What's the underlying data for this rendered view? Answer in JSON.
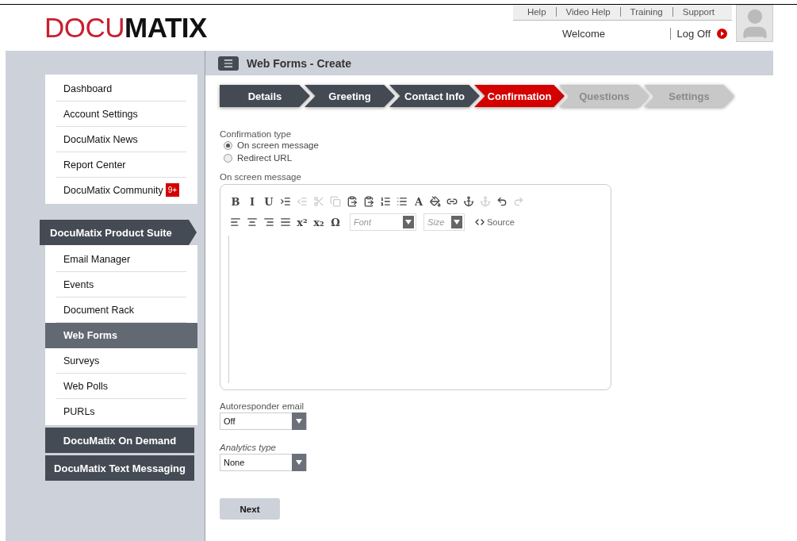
{
  "header": {
    "logo": "DOCU**MATIX**",
    "links": [
      "Help",
      "Video Help",
      "Training",
      "Support"
    ],
    "welcome": "Welcome",
    "logoff": "Log Off"
  },
  "page_title": "Web Forms - Create",
  "sidebar": {
    "top_items": [
      {
        "label": "Dashboard"
      },
      {
        "label": "Account Settings"
      },
      {
        "label": "DocuMatix News"
      },
      {
        "label": "Report Center"
      },
      {
        "label": "DocuMatix Community",
        "badge": "9+"
      }
    ],
    "sections": [
      {
        "label": "DocuMatix Product Suite",
        "expanded": true,
        "items": [
          {
            "label": "Email Manager",
            "selected": false
          },
          {
            "label": "Events",
            "selected": false
          },
          {
            "label": "Document Rack",
            "selected": false
          },
          {
            "label": "Web Forms",
            "selected": true
          },
          {
            "label": "Surveys",
            "selected": false
          },
          {
            "label": "Web Polls",
            "selected": false
          },
          {
            "label": "PURLs",
            "selected": false
          }
        ]
      },
      {
        "label": "DocuMatix On Demand",
        "expanded": false
      },
      {
        "label": "DocuMatix Text Messaging",
        "expanded": false
      }
    ]
  },
  "steps": [
    {
      "label": "Details",
      "completed": true,
      "selected": false
    },
    {
      "label": "Greeting",
      "completed": true,
      "selected": false
    },
    {
      "label": "Contact Info",
      "completed": true,
      "selected": false
    },
    {
      "label": "Confirmation",
      "completed": false,
      "selected": true
    },
    {
      "label": "Questions",
      "completed": false,
      "selected": false
    },
    {
      "label": "Settings",
      "completed": false,
      "selected": false
    }
  ],
  "confirmation_type": {
    "label": "Confirmation type",
    "options": [
      {
        "label": "On screen message",
        "selected": true
      },
      {
        "label": "Redirect URL",
        "selected": false
      }
    ]
  },
  "editor": {
    "label": "On screen message",
    "toolbar_1": [
      {
        "kind": "glyph",
        "label": "B",
        "disabled": false
      },
      {
        "kind": "glyph",
        "label": "I",
        "disabled": false
      },
      {
        "kind": "glyph",
        "label": "U",
        "disabled": false
      },
      {
        "kind": "indent",
        "disabled": false
      },
      {
        "kind": "outdent",
        "disabled": true
      },
      {
        "kind": "cut",
        "disabled": true
      },
      {
        "kind": "copy",
        "disabled": true
      },
      {
        "kind": "paste",
        "disabled": false
      },
      {
        "kind": "paste",
        "disabled": false
      },
      {
        "kind": "ordered-list",
        "disabled": false
      },
      {
        "kind": "bullet-list",
        "disabled": false
      },
      {
        "kind": "glyph",
        "label": "A",
        "disabled": false
      },
      {
        "kind": "fill",
        "disabled": false
      },
      {
        "kind": "link",
        "disabled": false
      },
      {
        "kind": "anchor",
        "disabled": false
      },
      {
        "kind": "anchor",
        "disabled": true
      },
      {
        "kind": "undo",
        "disabled": false
      },
      {
        "kind": "redo",
        "disabled": true
      }
    ],
    "toolbar_2": [
      {
        "kind": "align-left",
        "disabled": false
      },
      {
        "kind": "align-center",
        "disabled": false
      },
      {
        "kind": "align-right",
        "disabled": false
      },
      {
        "kind": "align-justify",
        "disabled": false
      },
      {
        "kind": "glyph",
        "label": "x²",
        "disabled": false
      },
      {
        "kind": "glyph",
        "label": "x₂",
        "disabled": false
      },
      {
        "kind": "glyph",
        "label": "Ω",
        "disabled": false
      }
    ],
    "font_placeholder": "Font",
    "size_placeholder": "Size",
    "source": "Source"
  },
  "autoresponder": {
    "label": "Autoresponder email",
    "value": "Off"
  },
  "analytics": {
    "label": "Analytics type",
    "value": "None"
  },
  "next_button": "Next"
}
